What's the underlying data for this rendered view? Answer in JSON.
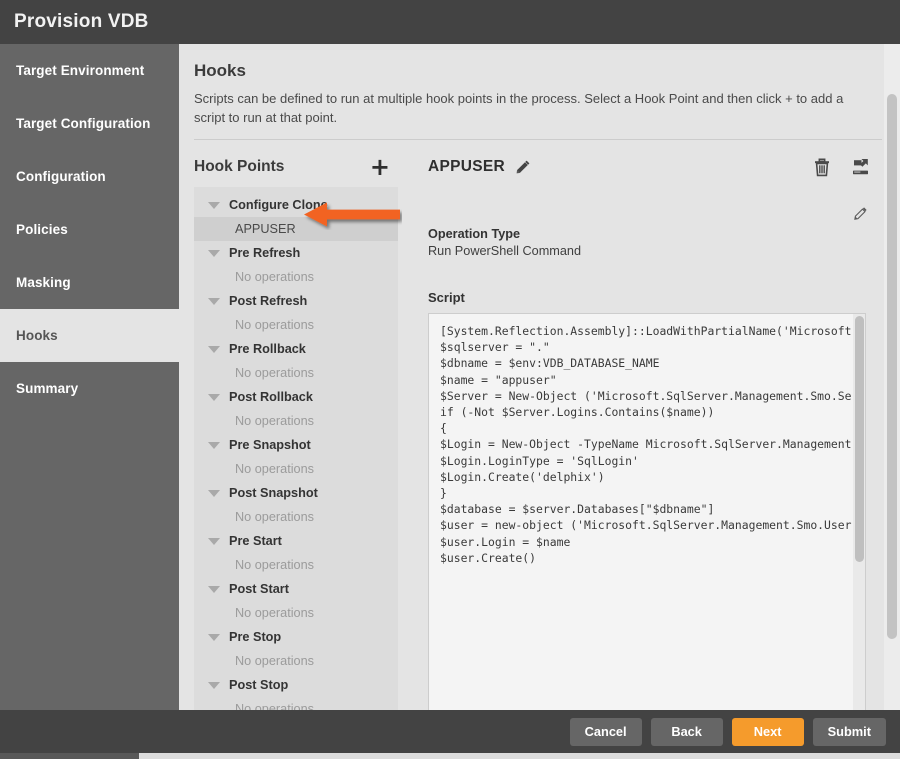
{
  "window": {
    "title": "Provision VDB"
  },
  "sidebar": {
    "items": [
      {
        "label": "Target Environment",
        "active": false
      },
      {
        "label": "Target Configuration",
        "active": false
      },
      {
        "label": "Configuration",
        "active": false
      },
      {
        "label": "Policies",
        "active": false
      },
      {
        "label": "Masking",
        "active": false
      },
      {
        "label": "Hooks",
        "active": true
      },
      {
        "label": "Summary",
        "active": false
      }
    ]
  },
  "main": {
    "title": "Hooks",
    "description": "Scripts can be defined to run at multiple hook points in the process. Select a Hook Point and then click + to add a script to run at that point."
  },
  "hook_points": {
    "heading": "Hook Points",
    "add_label": "+",
    "empty_text": "No operations",
    "groups": [
      {
        "label": "Configure Clone",
        "children": [
          {
            "label": "APPUSER",
            "selected": true
          }
        ]
      },
      {
        "label": "Pre Refresh",
        "children": []
      },
      {
        "label": "Post Refresh",
        "children": []
      },
      {
        "label": "Pre Rollback",
        "children": []
      },
      {
        "label": "Post Rollback",
        "children": []
      },
      {
        "label": "Pre Snapshot",
        "children": []
      },
      {
        "label": "Post Snapshot",
        "children": []
      },
      {
        "label": "Pre Start",
        "children": []
      },
      {
        "label": "Post Start",
        "children": []
      },
      {
        "label": "Pre Stop",
        "children": []
      },
      {
        "label": "Post Stop",
        "children": []
      }
    ]
  },
  "detail": {
    "name": "APPUSER",
    "operation_type_label": "Operation Type",
    "operation_type_value": "Run PowerShell Command",
    "script_label": "Script",
    "script": "[System.Reflection.Assembly]::LoadWithPartialName('Microsoft.\n$sqlserver = \".\"\n$dbname = $env:VDB_DATABASE_NAME\n$name = \"appuser\"\n$Server = New-Object ('Microsoft.SqlServer.Management.Smo.Se\nif (-Not $Server.Logins.Contains($name))\n{\n$Login = New-Object -TypeName Microsoft.SqlServer.Management.\n$Login.LoginType = 'SqlLogin'\n$Login.Create('delphix')\n}\n$database = $server.Databases[\"$dbname\"]\n$user = new-object ('Microsoft.SqlServer.Management.Smo.User\n$user.Login = $name\n$user.Create()",
    "icons": {
      "edit_title": "pencil-icon",
      "delete": "trash-icon",
      "export": "export-icon",
      "edit_body": "pencil-icon"
    }
  },
  "footer": {
    "buttons": [
      {
        "label": "Cancel",
        "primary": false
      },
      {
        "label": "Back",
        "primary": false
      },
      {
        "label": "Next",
        "primary": true
      },
      {
        "label": "Submit",
        "primary": false
      }
    ]
  },
  "annotation": {
    "type": "arrow-left",
    "color": "#f26422",
    "points_at": "APPUSER"
  },
  "colors": {
    "header_bar": "#434343",
    "sidebar": "#666666",
    "page_bg": "#e4e4e4",
    "panel_bg": "#dcdcdc",
    "accent": "#f59b2c",
    "annotation": "#f26422"
  }
}
